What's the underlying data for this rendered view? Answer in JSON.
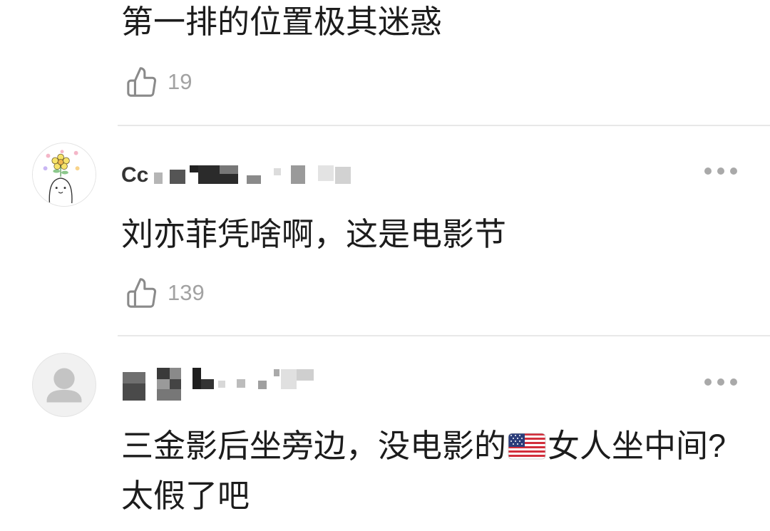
{
  "comments": [
    {
      "text": "第一排的位置极其迷惑",
      "likes": "19"
    },
    {
      "username_fragment": "Cc",
      "text": "刘亦菲凭啥啊，这是电影节",
      "likes": "139",
      "avatar": "cartoon-flower-avatar"
    },
    {
      "text_line1_before_flag": "三金影后坐旁边，没电影的",
      "flag": "us-flag-icon",
      "text_line1_after_flag": "女人坐中间?",
      "text_line2": "太假了吧",
      "avatar": "default-user-avatar"
    }
  ],
  "icons": {
    "like": "thumbs-up-icon",
    "more": "more-dots-icon"
  },
  "colors": {
    "text": "#1c1c1c",
    "secondary": "#a2a2a2",
    "divider": "#e8e8e8"
  }
}
